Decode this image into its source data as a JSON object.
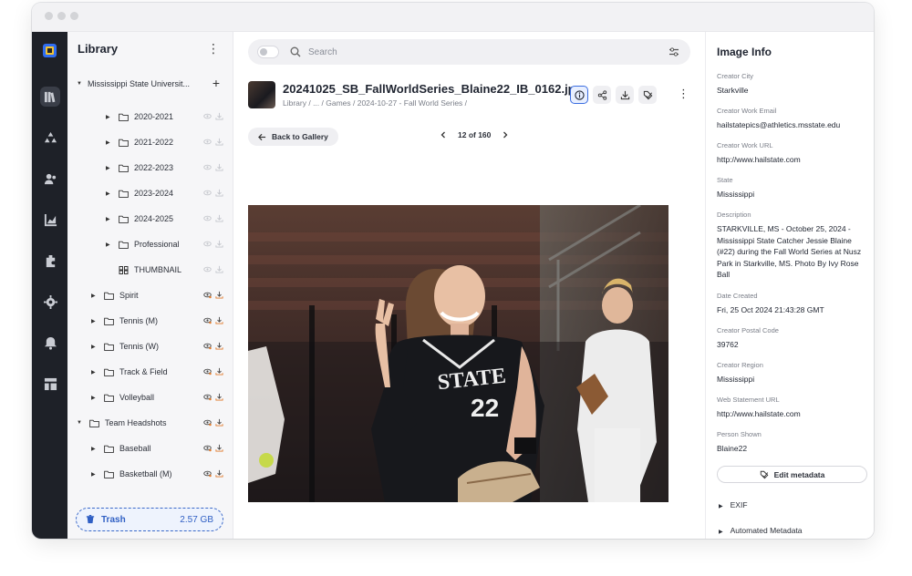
{
  "sidebar": {
    "title": "Library",
    "root": "Mississippi State Universit...",
    "items": [
      {
        "label": "2020-2021",
        "level": 2,
        "kind": "folder",
        "arrow": true
      },
      {
        "label": "2021-2022",
        "level": 2,
        "kind": "folder",
        "arrow": true
      },
      {
        "label": "2022-2023",
        "level": 2,
        "kind": "folder",
        "arrow": true
      },
      {
        "label": "2023-2024",
        "level": 2,
        "kind": "folder",
        "arrow": true
      },
      {
        "label": "2024-2025",
        "level": 2,
        "kind": "folder",
        "arrow": true
      },
      {
        "label": "Professional",
        "level": 2,
        "kind": "folder",
        "arrow": true
      },
      {
        "label": "THUMBNAIL",
        "level": 2,
        "kind": "grid",
        "arrow": false
      },
      {
        "label": "Spirit",
        "level": 1,
        "kind": "folder",
        "arrow": true
      },
      {
        "label": "Tennis (M)",
        "level": 1,
        "kind": "folder",
        "arrow": true
      },
      {
        "label": "Tennis (W)",
        "level": 1,
        "kind": "folder",
        "arrow": true
      },
      {
        "label": "Track & Field",
        "level": 1,
        "kind": "folder",
        "arrow": true
      },
      {
        "label": "Volleyball",
        "level": 1,
        "kind": "folder",
        "arrow": true
      },
      {
        "label": "Team Headshots",
        "level": 0,
        "kind": "folder",
        "arrow": true,
        "open": true
      },
      {
        "label": "Baseball",
        "level": 1,
        "kind": "folder",
        "arrow": true
      },
      {
        "label": "Basketball (M)",
        "level": 1,
        "kind": "folder",
        "arrow": true
      }
    ],
    "trash_label": "Trash",
    "trash_size": "2.57 GB"
  },
  "search": {
    "placeholder": "Search"
  },
  "file": {
    "name": "20241025_SB_FallWorldSeries_Blaine22_IB_0162.jpg",
    "breadcrumb": "Library / ... / Games / 2024-10-27 - Fall World Series /"
  },
  "nav": {
    "back_label": "Back to Gallery",
    "pager": "12 of 160"
  },
  "photo": {
    "jersey_text": "STATE",
    "jersey_number": "22"
  },
  "info": {
    "title": "Image Info",
    "fields": [
      {
        "label": "Creator City",
        "value": "Starkville"
      },
      {
        "label": "Creator Work Email",
        "value": "hailstatepics@athletics.msstate.edu"
      },
      {
        "label": "Creator Work URL",
        "value": "http://www.hailstate.com"
      },
      {
        "label": "State",
        "value": "Mississippi"
      },
      {
        "label": "Description",
        "value": "STARKVILLE, MS - October 25, 2024 - Mississippi State Catcher Jessie Blaine (#22) during the Fall World Series at Nusz Park in Starkville, MS. Photo By Ivy Rose Ball"
      },
      {
        "label": "Date Created",
        "value": "Fri, 25 Oct 2024 21:43:28 GMT"
      },
      {
        "label": "Creator Postal Code",
        "value": "39762"
      },
      {
        "label": "Creator Region",
        "value": "Mississippi"
      },
      {
        "label": "Web Statement URL",
        "value": "http://www.hailstate.com"
      },
      {
        "label": "Person Shown",
        "value": "Blaine22"
      }
    ],
    "edit_label": "Edit metadata",
    "sections": [
      "EXIF",
      "Automated Metadata"
    ]
  },
  "colors": {
    "accent": "#3b6de0",
    "rail": "#1e2128",
    "visible_icon": "#e07a2c"
  }
}
